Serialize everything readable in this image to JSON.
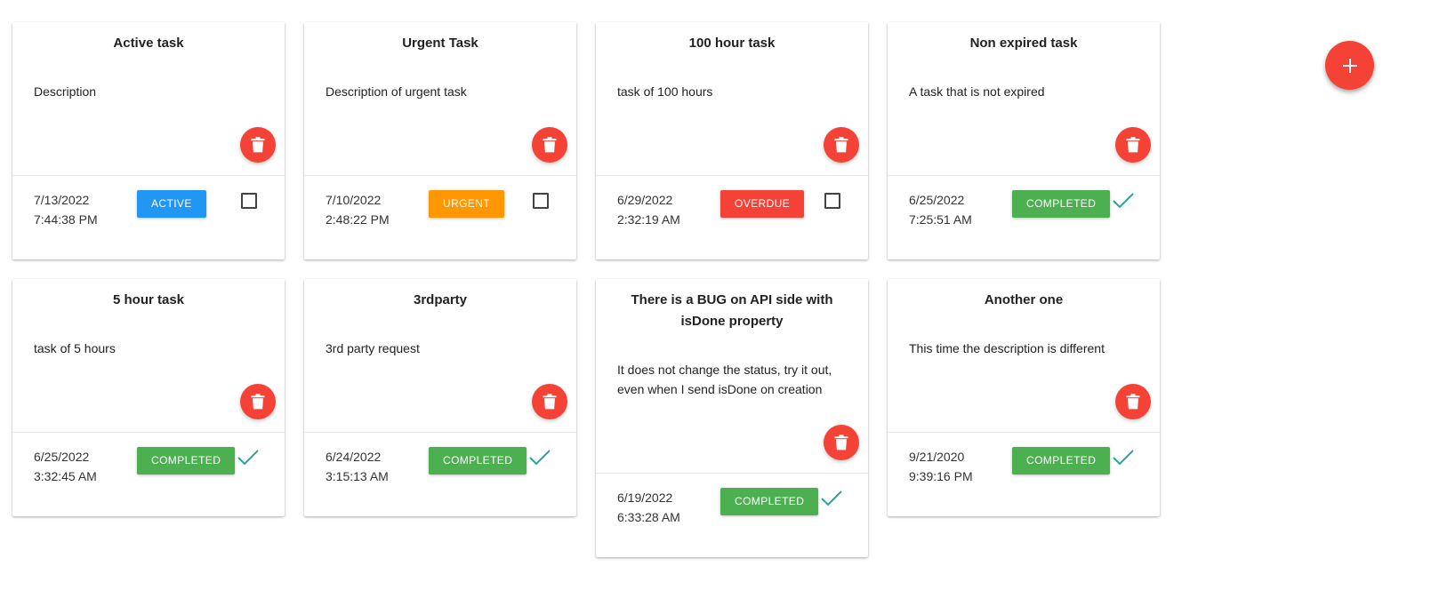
{
  "colors": {
    "accent": "#f44336",
    "active": "#2196f3",
    "urgent": "#ff9800",
    "overdue": "#f44336",
    "completed": "#4caf50",
    "check": "#26a69a"
  },
  "fab": {
    "icon": "plus-icon"
  },
  "tasks": [
    {
      "title": "Active task",
      "description": "Description",
      "date": "7/13/2022",
      "time": "7:44:38 PM",
      "status": "ACTIVE",
      "status_type": "active",
      "done": false
    },
    {
      "title": "Urgent Task",
      "description": "Description of urgent task",
      "date": "7/10/2022",
      "time": "2:48:22 PM",
      "status": "URGENT",
      "status_type": "urgent",
      "done": false
    },
    {
      "title": "100 hour task",
      "description": "task of 100 hours",
      "date": "6/29/2022",
      "time": "2:32:19 AM",
      "status": "OVERDUE",
      "status_type": "overdue",
      "done": false
    },
    {
      "title": "Non expired task",
      "description": "A task that is not expired",
      "date": "6/25/2022",
      "time": "7:25:51 AM",
      "status": "COMPLETED",
      "status_type": "completed",
      "done": true
    },
    {
      "title": "5 hour task",
      "description": "task of 5 hours",
      "date": "6/25/2022",
      "time": "3:32:45 AM",
      "status": "COMPLETED",
      "status_type": "completed",
      "done": true
    },
    {
      "title": "3rdparty",
      "description": "3rd party request",
      "date": "6/24/2022",
      "time": "3:15:13 AM",
      "status": "COMPLETED",
      "status_type": "completed",
      "done": true
    },
    {
      "title": "There is a BUG on API side with isDone property",
      "description": "It does not change the status, try it out, even when I send isDone on creation",
      "date": "6/19/2022",
      "time": "6:33:28 AM",
      "status": "COMPLETED",
      "status_type": "completed",
      "done": true
    },
    {
      "title": "Another one",
      "description": "This time the description is different",
      "date": "9/21/2020",
      "time": "9:39:16 PM",
      "status": "COMPLETED",
      "status_type": "completed",
      "done": true
    }
  ]
}
